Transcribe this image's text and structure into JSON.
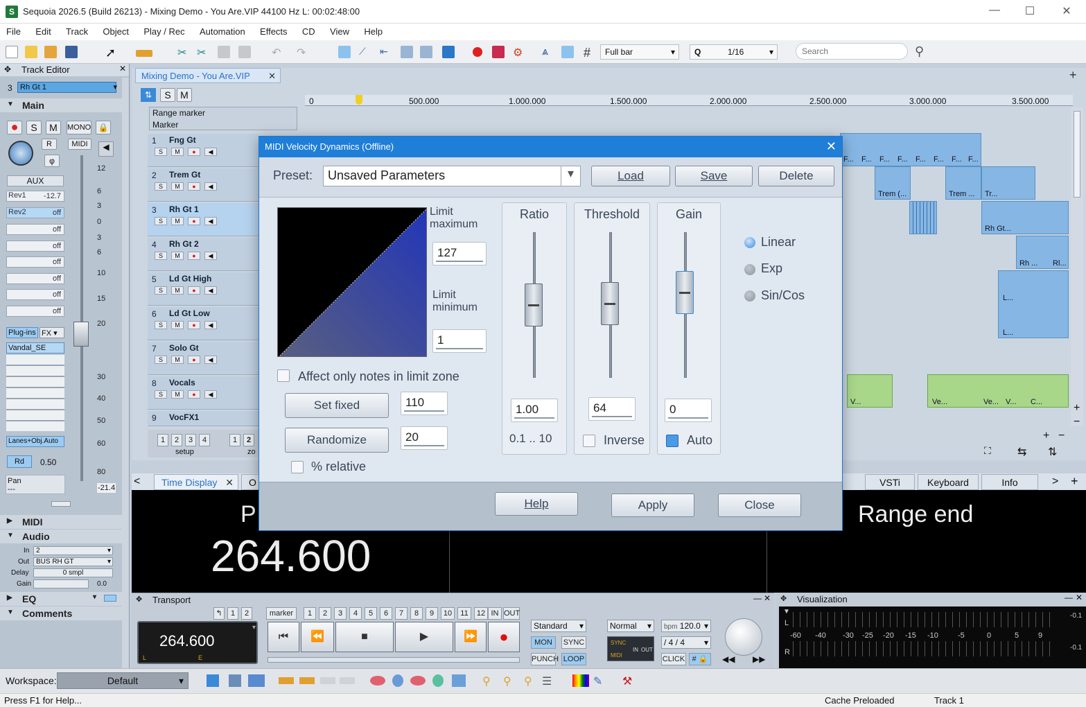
{
  "window": {
    "title": "Sequoia 2026.5 (Build 26213) - Mixing Demo - You Are.VIP   44100 Hz L: 00:02:48:00"
  },
  "menu": [
    "File",
    "Edit",
    "Track",
    "Object",
    "Play / Rec",
    "Automation",
    "Effects",
    "CD",
    "View",
    "Help"
  ],
  "toolbar": {
    "grid_mode": "Full bar",
    "quantize_label": "Q",
    "quantize": "1/16",
    "search_placeholder": "Search"
  },
  "track_editor": {
    "title": "Track Editor",
    "track_num": "3",
    "track_name": "Rh Gt 1",
    "main_label": "Main",
    "btn_mono": "MONO",
    "btn_r": "R",
    "btn_midi": "MIDI",
    "aux_label": "AUX",
    "aux_rows": [
      {
        "name": "Rev1",
        "value": "-12.7"
      },
      {
        "name": "Rev2",
        "value": "off"
      },
      {
        "name": "",
        "value": "off"
      },
      {
        "name": "",
        "value": "off"
      },
      {
        "name": "",
        "value": "off"
      },
      {
        "name": "",
        "value": "off"
      },
      {
        "name": "",
        "value": "off"
      },
      {
        "name": "",
        "value": "off"
      }
    ],
    "scale": [
      "12",
      "6",
      "3",
      "0",
      "3",
      "6",
      "10",
      "15",
      "20",
      "30",
      "40",
      "50",
      "60",
      "80"
    ],
    "plugins_label": "Plug-ins",
    "fx_label": "FX",
    "plugin": "Vandal_SE",
    "lanes_auto": "Lanes+Obj.Auto",
    "rd_label": "Rd",
    "rd_value": "0.50",
    "pan_label": "Pan",
    "pan_value": "---",
    "fader_value": "-21.4",
    "midi_section": "MIDI",
    "audio_section": "Audio",
    "audio_in_label": "In",
    "audio_in": "2",
    "audio_out_label": "Out",
    "audio_out": "BUS RH GT",
    "delay_label": "Delay",
    "delay": "0 smpl",
    "gain_label": "Gain",
    "gain": "0.0",
    "eq_section": "EQ",
    "comments_section": "Comments"
  },
  "project_tab": "Mixing Demo - You Are.VIP",
  "markers": {
    "range_marker": "Range marker",
    "marker": "Marker"
  },
  "ruler": [
    "0",
    "500.000",
    "1.000.000",
    "1.500.000",
    "2.000.000",
    "2.500.000",
    "3.000.000",
    "3.500.000"
  ],
  "tracks": [
    {
      "num": "1",
      "name": "Fng Gt"
    },
    {
      "num": "2",
      "name": "Trem Gt"
    },
    {
      "num": "3",
      "name": "Rh Gt 1"
    },
    {
      "num": "4",
      "name": "Rh Gt 2"
    },
    {
      "num": "5",
      "name": "Ld Gt High"
    },
    {
      "num": "6",
      "name": "Ld Gt Low"
    },
    {
      "num": "7",
      "name": "Solo Gt"
    },
    {
      "num": "8",
      "name": "Vocals"
    },
    {
      "num": "9",
      "name": "VocFX1"
    }
  ],
  "track_btns": {
    "s": "S",
    "m": "M"
  },
  "clips": {
    "f": "F...",
    "trem": "Trem (...",
    "trem2": "Trem ...",
    "tr": "Tr...",
    "rhgt": "Rh Gt...",
    "rh": "Rh ...",
    "rl": "Rl...",
    "l": "L...",
    "vo1": "V...",
    "vo2": "Ve...",
    "vo3": "Ve...",
    "vo4": "V...",
    "vo5": "C..."
  },
  "bottom_setup": {
    "setup": "setup",
    "zo": "zo",
    "nums": [
      "1",
      "2",
      "3",
      "4"
    ],
    "nums2": [
      "1",
      "2"
    ]
  },
  "dialog": {
    "title": "MIDI Velocity Dynamics (Offline)",
    "preset_label": "Preset:",
    "preset_value": "Unsaved Parameters",
    "load": "Load",
    "save": "Save",
    "delete": "Delete",
    "limit_max_label": "Limit maximum",
    "limit_max": "127",
    "limit_min_label": "Limit minimum",
    "limit_min": "1",
    "affect_label": "Affect only notes in limit zone",
    "set_fixed": "Set fixed",
    "set_fixed_value": "110",
    "randomize": "Randomize",
    "randomize_value": "20",
    "percent_relative": "% relative",
    "ratio_label": "Ratio",
    "ratio_value": "1.00",
    "ratio_range": "0.1 .. 10",
    "threshold_label": "Threshold",
    "threshold_value": "64",
    "inverse_label": "Inverse",
    "gain_label": "Gain",
    "gain_value": "0",
    "auto_label": "Auto",
    "curves": [
      "Linear",
      "Exp",
      "Sin/Cos"
    ],
    "help": "Help",
    "apply": "Apply",
    "close": "Close"
  },
  "bottom_tabs": {
    "time_display": "Time Display",
    "o": "O",
    "vsti": "VSTi",
    "keyboard": "Keyboard",
    "info": "Info"
  },
  "time_display": {
    "left_label": "P",
    "big_value": "264.600",
    "right_label": "Range end"
  },
  "transport": {
    "title": "Transport",
    "position": "264.600",
    "marker_label": "marker",
    "marker_nums": [
      "1",
      "2",
      "3",
      "4",
      "5",
      "6",
      "7",
      "8",
      "9",
      "10",
      "11",
      "12"
    ],
    "small_nums": [
      "1",
      "2"
    ],
    "in": "IN",
    "out": "OUT",
    "standard": "Standard",
    "mon": "MON",
    "sync": "SYNC",
    "punch": "PUNCH",
    "loop": "LOOP",
    "normal": "Normal",
    "bpm_label": "bpm",
    "bpm": "120.0",
    "signature": "4 / 4",
    "click": "CLICK",
    "sync_label": "SYNC",
    "midi_label": "MIDI",
    "in_label": "IN",
    "out_label": "OUT",
    "le_l": "L",
    "le_e": "E"
  },
  "visualization": {
    "title": "Visualization",
    "scale": [
      "-60",
      "-40",
      "-30",
      "-25",
      "-20",
      "-15",
      "-10",
      "-5",
      "0",
      "5",
      "9"
    ],
    "l": "L",
    "r": "R",
    "val1": "-0.1",
    "val2": "-0.1"
  },
  "workspace": {
    "label": "Workspace:",
    "value": "Default"
  },
  "status": {
    "help": "Press F1 for Help...",
    "cache": "Cache Preloaded",
    "track": "Track 1"
  },
  "colors": {
    "accent": "#1f7ed8",
    "track_bg": "#ccd6e0",
    "clip_blue": "#86b7e4",
    "clip_green": "#a8d78a"
  }
}
